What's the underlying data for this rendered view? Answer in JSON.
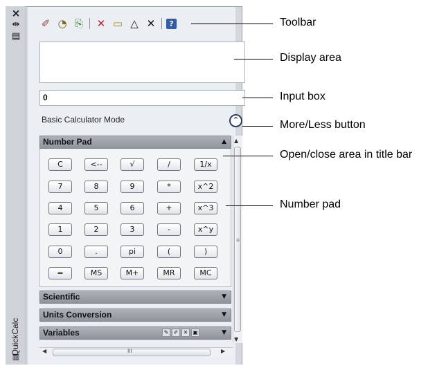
{
  "side": {
    "close_icon": "×",
    "autohide_icon": "⇹",
    "properties_icon": "▤",
    "title": "QuickCalc"
  },
  "toolbar": {
    "icons": [
      "clear-icon",
      "clear-history-icon",
      "paste-icon",
      "get-coordinates-icon",
      "distance-icon",
      "angle-icon",
      "intersection-icon",
      "help-icon"
    ]
  },
  "input": {
    "value": "0"
  },
  "mode_label": "Basic Calculator Mode",
  "more_less_glyph": "⌃",
  "sections": {
    "number_pad": "Number Pad",
    "scientific": "Scientific",
    "units": "Units Conversion",
    "variables": "Variables"
  },
  "keys": [
    [
      "C",
      "<--",
      "√",
      "/",
      "1/x"
    ],
    [
      "7",
      "8",
      "9",
      "*",
      "x^2"
    ],
    [
      "4",
      "5",
      "6",
      "+",
      "x^3"
    ],
    [
      "1",
      "2",
      "3",
      "-",
      "x^y"
    ],
    [
      "0",
      ".",
      "pi",
      "(",
      ")"
    ],
    [
      "=",
      "MS",
      "M+",
      "MR",
      "MC"
    ]
  ],
  "scroll": {
    "vgrip": "≡",
    "hgrip": "III"
  },
  "callouts": {
    "toolbar": "Toolbar",
    "display": "Display area",
    "input": "Input box",
    "more_less": "More/Less button",
    "open_close": "Open/close area in title bar",
    "number_pad": "Number pad"
  }
}
